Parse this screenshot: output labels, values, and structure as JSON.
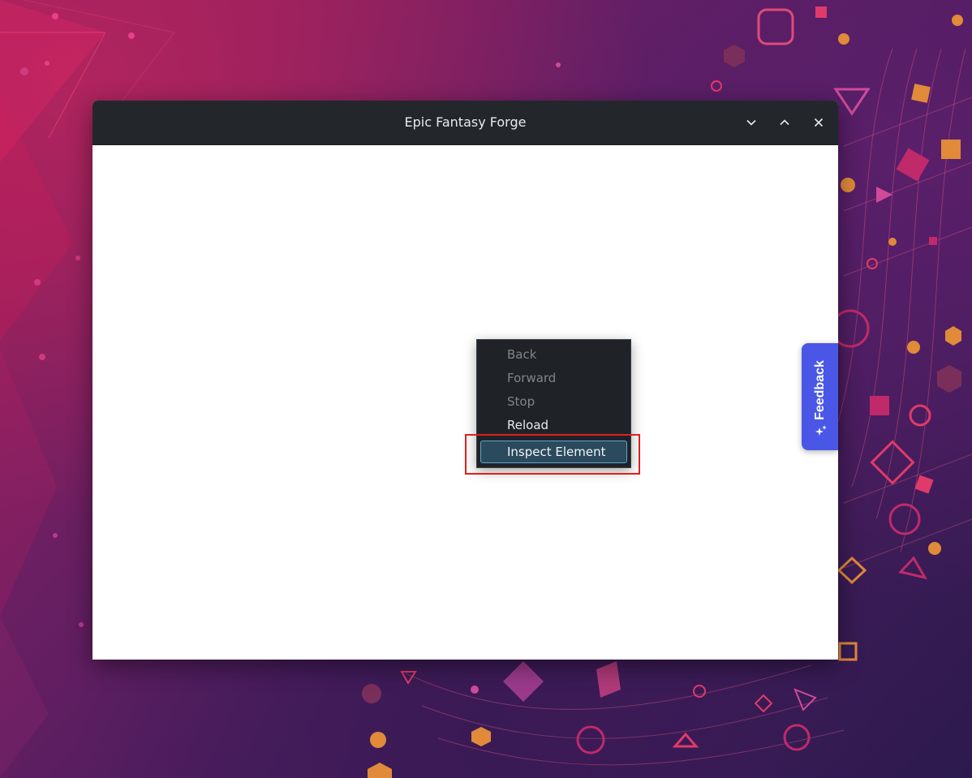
{
  "window": {
    "title": "Epic Fantasy Forge",
    "controls": [
      "minimize-icon",
      "maximize-icon",
      "close-icon"
    ]
  },
  "context_menu": {
    "items": [
      {
        "label": "Back",
        "enabled": false
      },
      {
        "label": "Forward",
        "enabled": false
      },
      {
        "label": "Stop",
        "enabled": false
      },
      {
        "label": "Reload",
        "enabled": true
      },
      {
        "label": "Inspect Element",
        "enabled": true,
        "highlighted": true
      }
    ]
  },
  "feedback": {
    "label": "Feedback",
    "icon": "sparkle-icon",
    "color": "#4a57e6"
  },
  "colors": {
    "titlebar": "#23272c",
    "menu_background": "#1f2327",
    "menu_highlight": "#2b4a5e",
    "highlight_box": "#e0201e"
  }
}
